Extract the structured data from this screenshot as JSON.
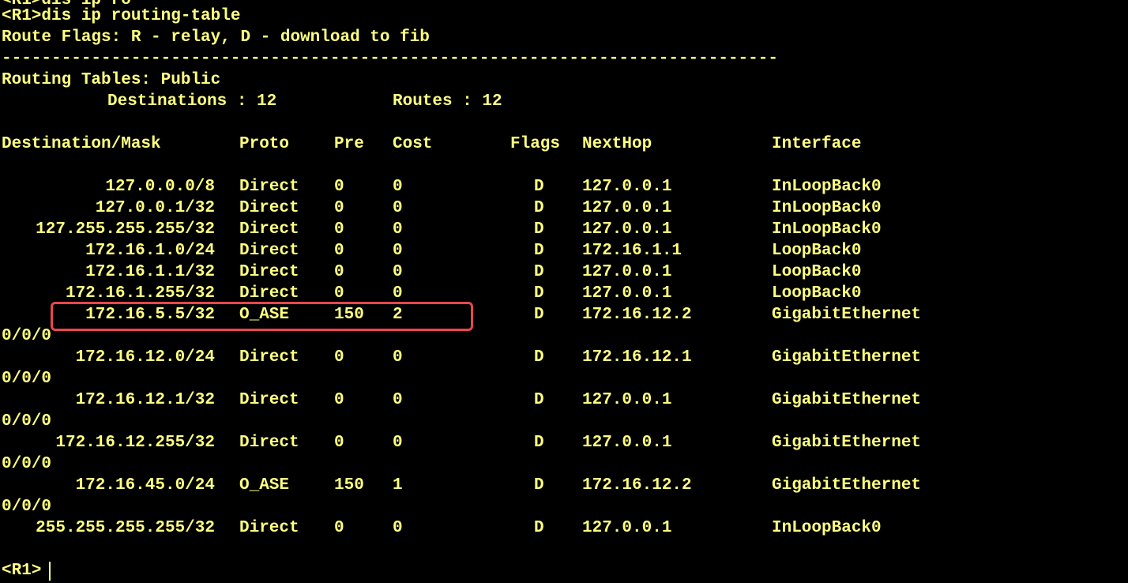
{
  "terminal": {
    "partial_top_line": "<R1>dis ip ro",
    "command_line": "<R1>dis ip routing-table",
    "route_flags_line": "Route Flags: R - relay, D - download to fib",
    "separator": "------------------------------------------------------------------------------",
    "routing_tables_line": "Routing Tables: Public",
    "destinations_label": "Destinations : 12",
    "routes_label": "Routes : 12",
    "prompt": "<R1>",
    "colors": {
      "background": "#000000",
      "text": "#ffff80",
      "highlight": "#e8474c"
    }
  },
  "table": {
    "headers": {
      "destination": "Destination/Mask",
      "proto": "Proto",
      "pre": "Pre",
      "cost": "Cost",
      "flags": "Flags",
      "nexthop": "NextHop",
      "interface": "Interface"
    },
    "rows": [
      {
        "destination": "127.0.0.0/8",
        "proto": "Direct",
        "pre": "0",
        "cost": "0",
        "flags": "D",
        "nexthop": "127.0.0.1",
        "interface": "InLoopBack0",
        "wrap": ""
      },
      {
        "destination": "127.0.0.1/32",
        "proto": "Direct",
        "pre": "0",
        "cost": "0",
        "flags": "D",
        "nexthop": "127.0.0.1",
        "interface": "InLoopBack0",
        "wrap": ""
      },
      {
        "destination": "127.255.255.255/32",
        "proto": "Direct",
        "pre": "0",
        "cost": "0",
        "flags": "D",
        "nexthop": "127.0.0.1",
        "interface": "InLoopBack0",
        "wrap": ""
      },
      {
        "destination": "172.16.1.0/24",
        "proto": "Direct",
        "pre": "0",
        "cost": "0",
        "flags": "D",
        "nexthop": "172.16.1.1",
        "interface": "LoopBack0",
        "wrap": ""
      },
      {
        "destination": "172.16.1.1/32",
        "proto": "Direct",
        "pre": "0",
        "cost": "0",
        "flags": "D",
        "nexthop": "127.0.0.1",
        "interface": "LoopBack0",
        "wrap": ""
      },
      {
        "destination": "172.16.1.255/32",
        "proto": "Direct",
        "pre": "0",
        "cost": "0",
        "flags": "D",
        "nexthop": "127.0.0.1",
        "interface": "LoopBack0",
        "wrap": ""
      },
      {
        "destination": "172.16.5.5/32",
        "proto": "O_ASE",
        "pre": "150",
        "cost": "2",
        "flags": "D",
        "nexthop": "172.16.12.2",
        "interface": "GigabitEthernet",
        "wrap": "0/0/0"
      },
      {
        "destination": "172.16.12.0/24",
        "proto": "Direct",
        "pre": "0",
        "cost": "0",
        "flags": "D",
        "nexthop": "172.16.12.1",
        "interface": "GigabitEthernet",
        "wrap": "0/0/0"
      },
      {
        "destination": "172.16.12.1/32",
        "proto": "Direct",
        "pre": "0",
        "cost": "0",
        "flags": "D",
        "nexthop": "127.0.0.1",
        "interface": "GigabitEthernet",
        "wrap": "0/0/0"
      },
      {
        "destination": "172.16.12.255/32",
        "proto": "Direct",
        "pre": "0",
        "cost": "0",
        "flags": "D",
        "nexthop": "127.0.0.1",
        "interface": "GigabitEthernet",
        "wrap": "0/0/0"
      },
      {
        "destination": "172.16.45.0/24",
        "proto": "O_ASE",
        "pre": "150",
        "cost": "1",
        "flags": "D",
        "nexthop": "172.16.12.2",
        "interface": "GigabitEthernet",
        "wrap": "0/0/0"
      },
      {
        "destination": "255.255.255.255/32",
        "proto": "Direct",
        "pre": "0",
        "cost": "0",
        "flags": "D",
        "nexthop": "127.0.0.1",
        "interface": "InLoopBack0",
        "wrap": ""
      }
    ]
  }
}
